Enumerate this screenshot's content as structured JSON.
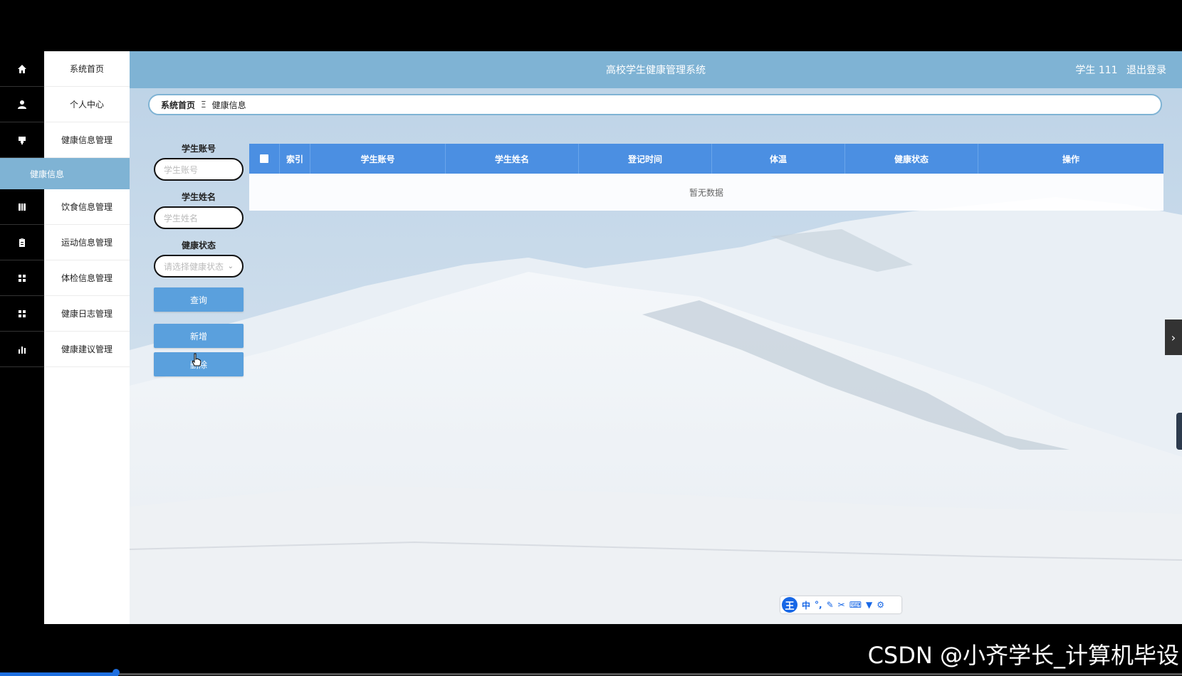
{
  "header": {
    "title": "高校学生健康管理系统",
    "user": "学生 111",
    "logout": "退出登录"
  },
  "menu": {
    "items": [
      {
        "label": "系统首页",
        "icon": "home-icon"
      },
      {
        "label": "个人中心",
        "icon": "user-icon"
      },
      {
        "label": "健康信息管理",
        "icon": "monitor-icon"
      },
      {
        "label": "饮食信息管理",
        "icon": "book-icon"
      },
      {
        "label": "运动信息管理",
        "icon": "clipboard-icon"
      },
      {
        "label": "体检信息管理",
        "icon": "grid-icon"
      },
      {
        "label": "健康日志管理",
        "icon": "grid-icon"
      },
      {
        "label": "健康建议管理",
        "icon": "bar-chart-icon"
      }
    ],
    "sub_active": "健康信息"
  },
  "breadcrumb": {
    "home": "系统首页",
    "separator": "Ξ",
    "current": "健康信息"
  },
  "search": {
    "account_label": "学生账号",
    "account_placeholder": "学生账号",
    "name_label": "学生姓名",
    "name_placeholder": "学生姓名",
    "status_label": "健康状态",
    "status_placeholder": "请选择健康状态",
    "query_button": "查询",
    "add_button": "新增",
    "delete_button": "删除"
  },
  "table": {
    "columns": [
      "索引",
      "学生账号",
      "学生姓名",
      "登记时间",
      "体温",
      "健康状态",
      "操作"
    ],
    "empty_text": "暂无数据"
  },
  "ime": {
    "logo": "王",
    "mode": "中"
  },
  "watermark": "CSDN @小齐学长_计算机毕设",
  "colors": {
    "header": "#7fb3d4",
    "table_header": "#4b8fe2",
    "button": "#5aa0dd"
  }
}
